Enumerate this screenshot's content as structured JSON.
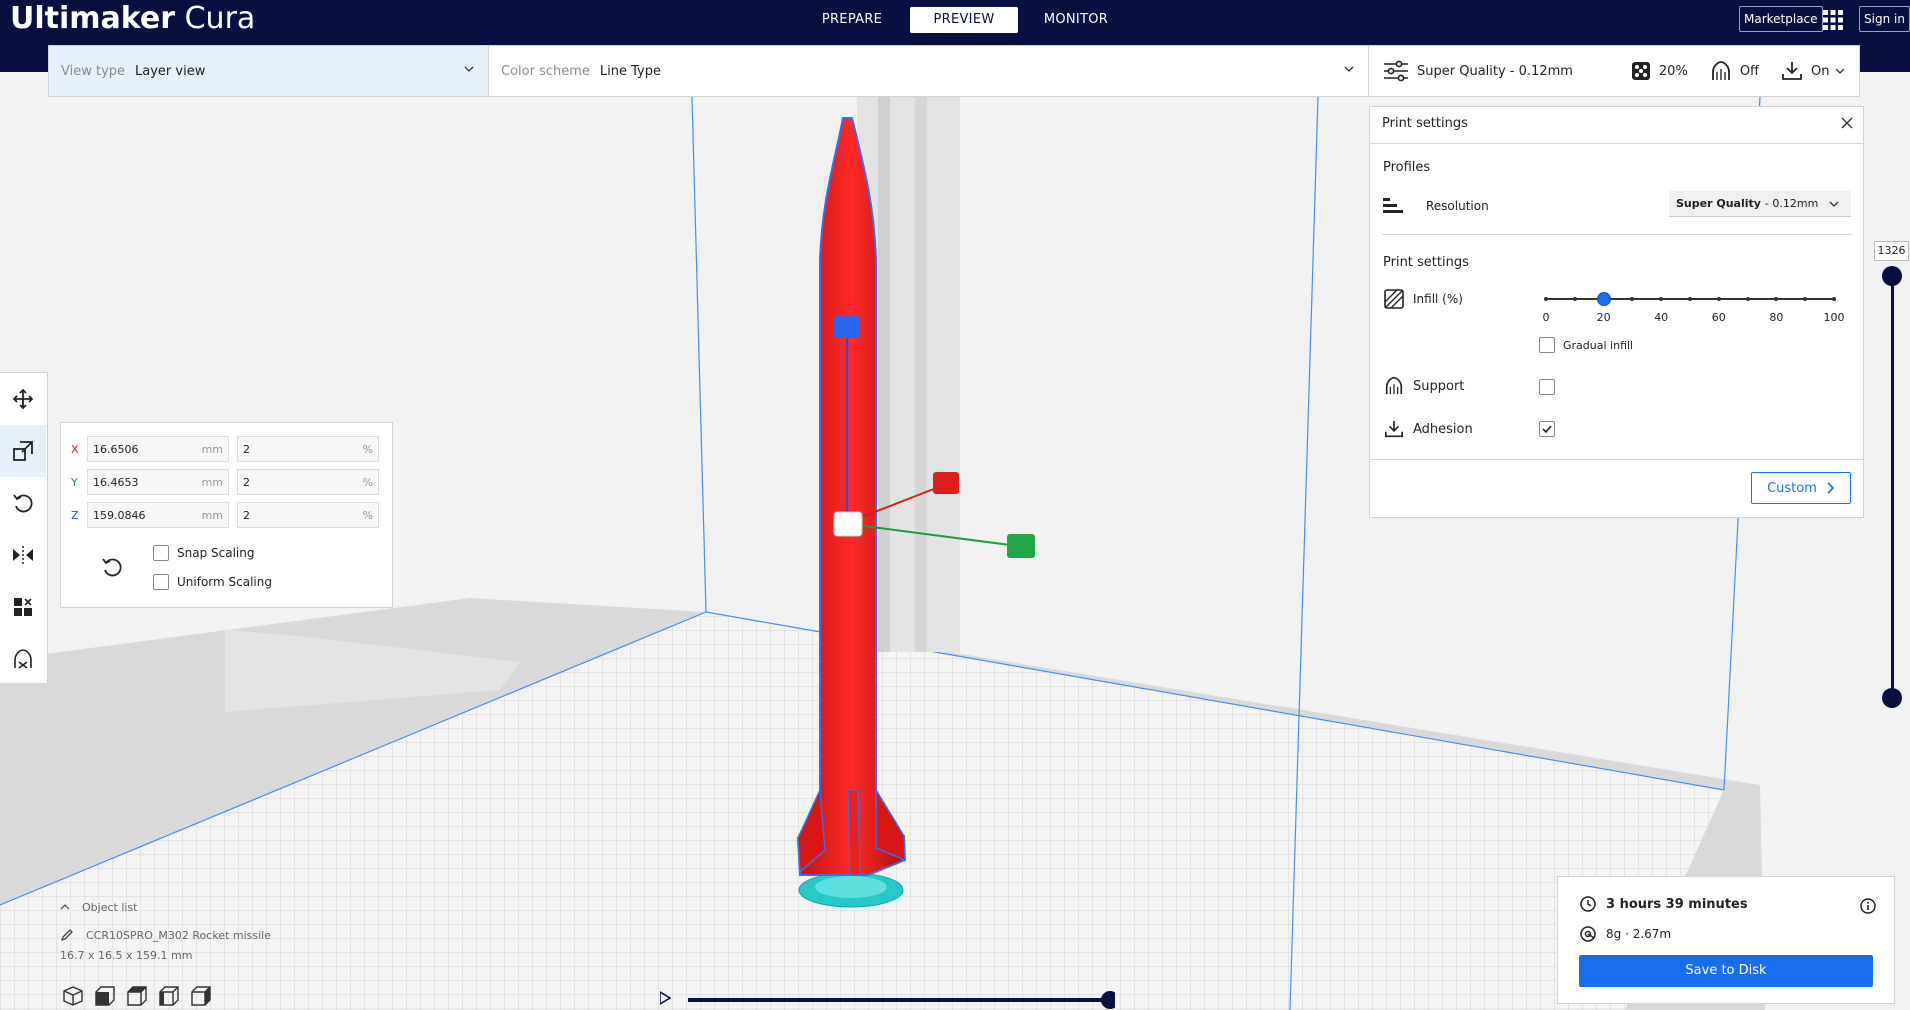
{
  "app": {
    "logo_bold": "Ultimaker",
    "logo_light": "Cura"
  },
  "stages": [
    {
      "label": "PREPARE"
    },
    {
      "label": "PREVIEW",
      "active": true
    },
    {
      "label": "MONITOR"
    }
  ],
  "header_buttons": {
    "marketplace": "Marketplace",
    "sign_in": "Sign in"
  },
  "toolbar": {
    "view_type_label": "View type",
    "view_type_value": "Layer view",
    "color_scheme_label": "Color scheme",
    "color_scheme_value": "Line Type",
    "profile": "Super Quality - 0.12mm",
    "infill": "20%",
    "support": "Off",
    "adhesion": "On"
  },
  "scale": {
    "x_axis": "X",
    "x_mm": "16.6506",
    "x_pct": "2",
    "y_axis": "Y",
    "y_mm": "16.4653",
    "y_pct": "2",
    "z_axis": "Z",
    "z_mm": "159.0846",
    "z_pct": "2",
    "unit_mm": "mm",
    "unit_pct": "%",
    "snap_scaling": "Snap Scaling",
    "uniform_scaling": "Uniform Scaling"
  },
  "print_settings": {
    "title": "Print settings",
    "profiles_heading": "Profiles",
    "resolution_label": "Resolution",
    "resolution_bold": "Super Quality",
    "resolution_rest": "- 0.12mm",
    "settings_heading": "Print settings",
    "infill_label": "Infill (%)",
    "infill_value": 20,
    "infill_ticks": [
      "0",
      "20",
      "40",
      "60",
      "80",
      "100"
    ],
    "gradual_infill": "Gradual infill",
    "support_label": "Support",
    "support_checked": false,
    "adhesion_label": "Adhesion",
    "adhesion_checked": true,
    "custom_button": "Custom"
  },
  "layer_slider": {
    "current_layer": "1326"
  },
  "object_list": {
    "header": "Object list",
    "object_name": "CCR10SPRO_M302 Rocket missile",
    "dimensions": "16.7 x 16.5 x 159.1 mm"
  },
  "estimate": {
    "time": "3 hours 39 minutes",
    "material": "8g · 2.67m",
    "save_button": "Save to Disk"
  },
  "colors": {
    "header": "#0a0f42",
    "accent": "#196ef0",
    "model": "#e31b1b"
  }
}
